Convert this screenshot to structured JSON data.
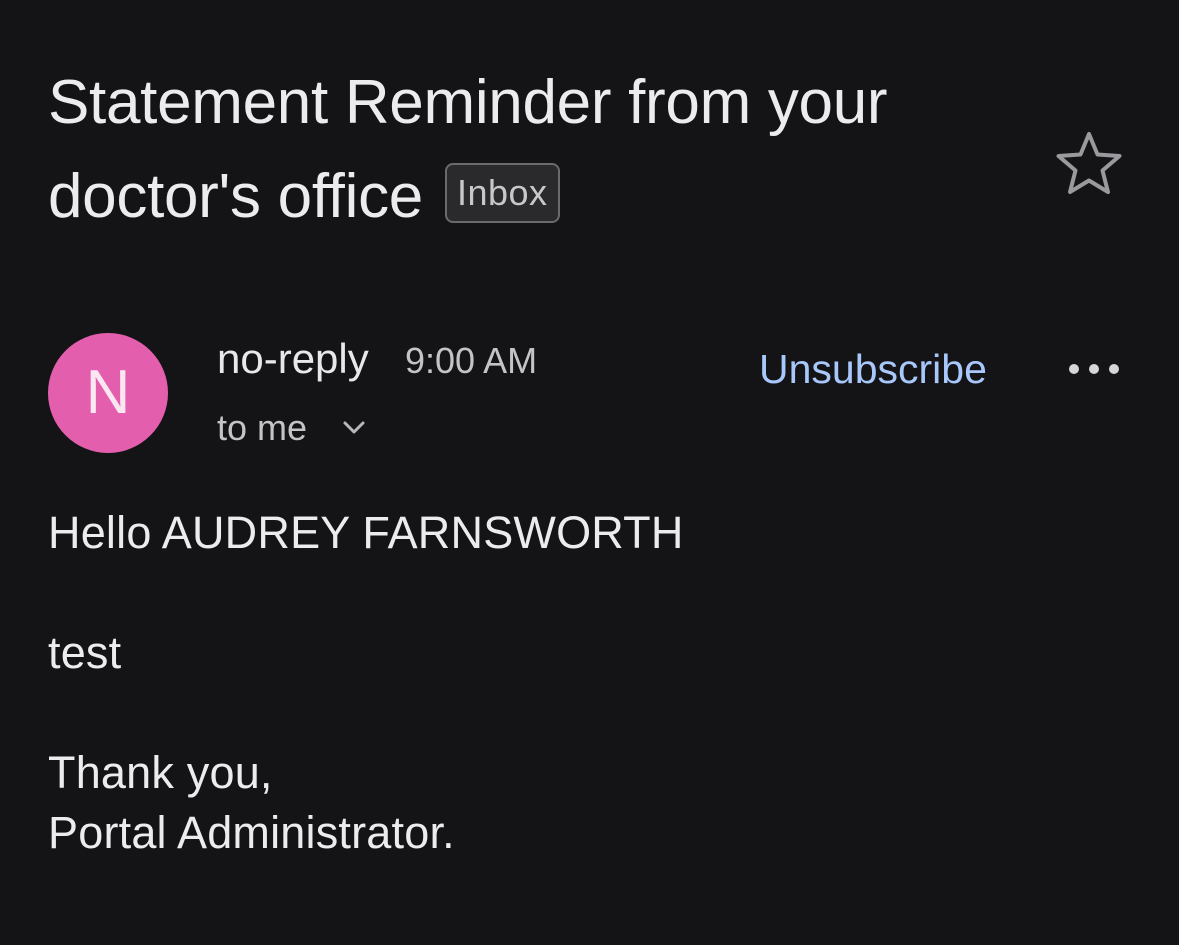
{
  "email": {
    "subject": "Statement Reminder from your doctor's office",
    "label": "Inbox",
    "sender": "no-reply",
    "avatar_letter": "N",
    "time": "9:00 AM",
    "recipient": "to me",
    "unsubscribe_label": "Unsubscribe",
    "body": {
      "greeting": "Hello AUDREY FARNSWORTH",
      "line1": "test",
      "signoff": "Thank you,",
      "signature": "Portal Administrator."
    }
  },
  "icons": {
    "star": "star-outline-icon",
    "chevron": "chevron-down-icon",
    "more": "more-horizontal-icon"
  },
  "colors": {
    "background": "#141416",
    "avatar": "#e35fae",
    "link": "#a8c7fa"
  }
}
